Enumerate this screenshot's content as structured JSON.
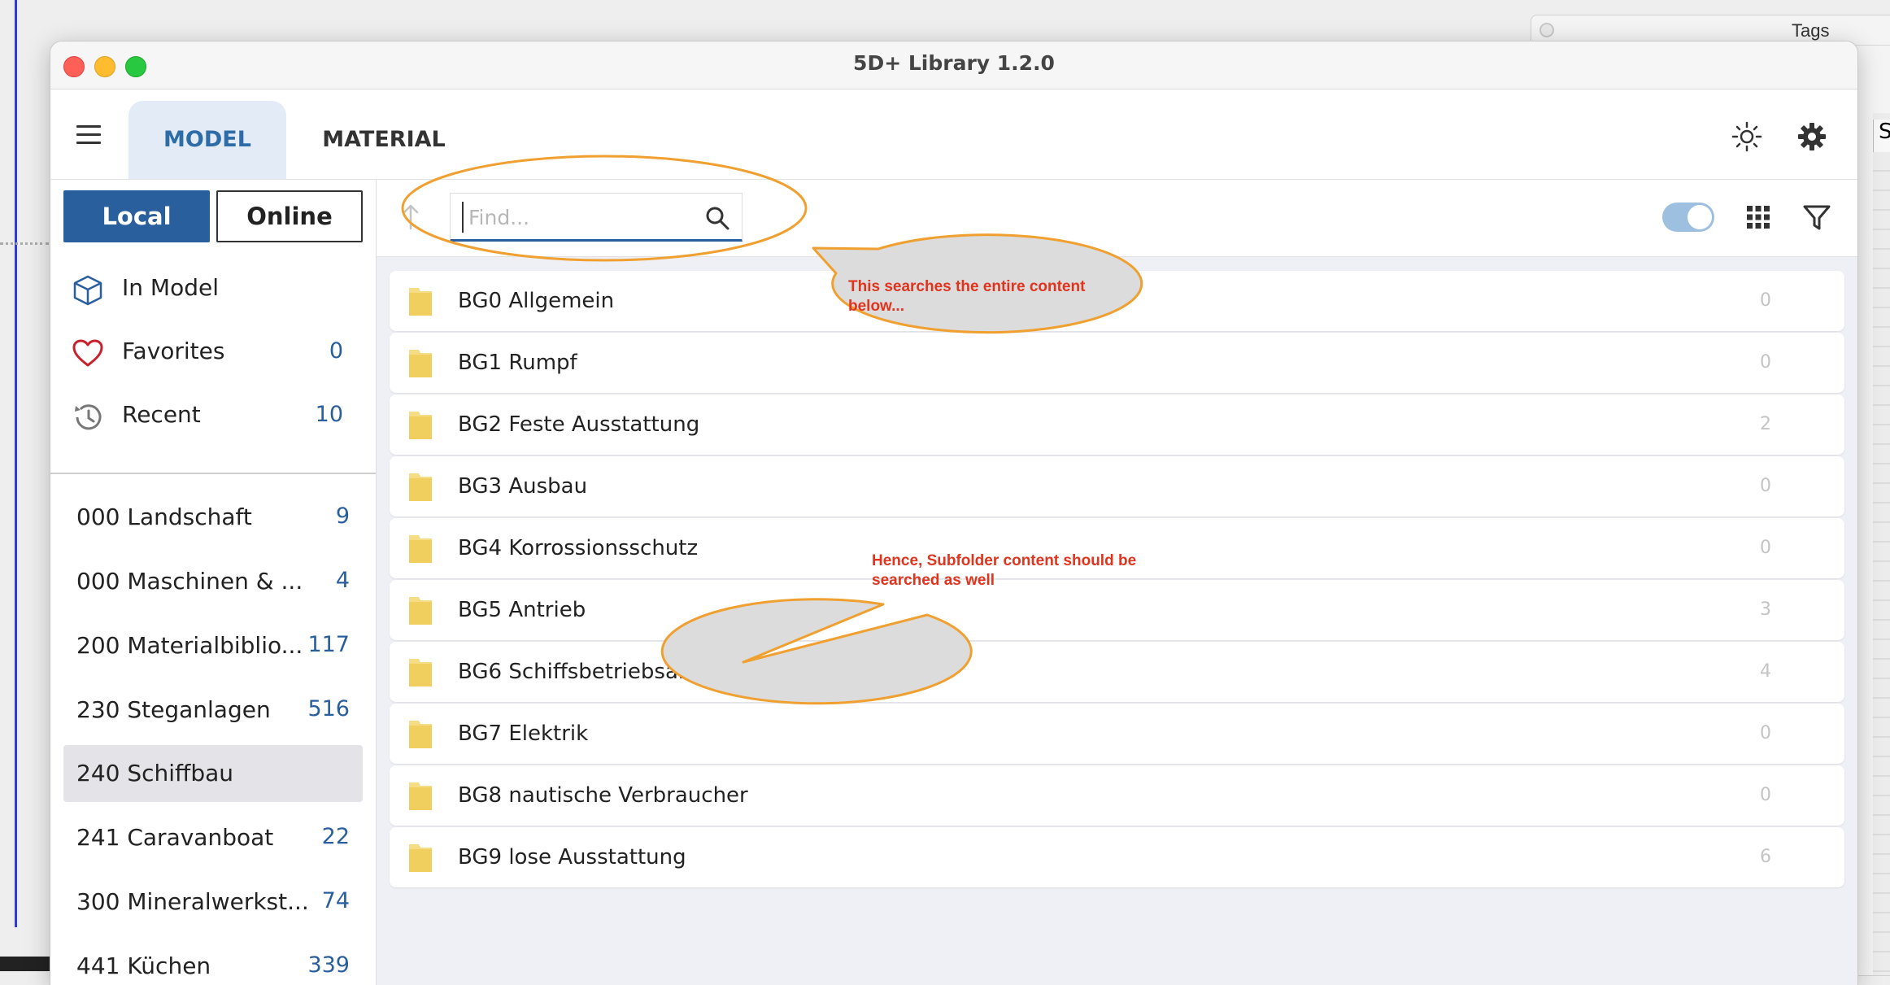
{
  "window": {
    "title": "5D+ Library 1.2.0"
  },
  "background_window": {
    "title": "Tags",
    "edge_letter": "S"
  },
  "topbar": {
    "tabs": [
      {
        "label": "MODEL",
        "active": true
      },
      {
        "label": "MATERIAL",
        "active": false
      }
    ],
    "icons": [
      "menu-icon",
      "sun-icon",
      "gear-icon"
    ]
  },
  "sidebar": {
    "segments": [
      {
        "label": "Local",
        "active": true
      },
      {
        "label": "Online",
        "active": false
      }
    ],
    "nav": [
      {
        "label": "In Model",
        "count": "",
        "icon": "cube-icon"
      },
      {
        "label": "Favorites",
        "count": "0",
        "icon": "heart-icon"
      },
      {
        "label": "Recent",
        "count": "10",
        "icon": "history-icon"
      }
    ],
    "categories": [
      {
        "label": "000 Landschaft",
        "count": "9"
      },
      {
        "label": "000 Maschinen & ...",
        "count": "4"
      },
      {
        "label": "200 Materialbiblio...",
        "count": "117"
      },
      {
        "label": "230 Steganlagen",
        "count": "516"
      },
      {
        "label": "240 Schiffbau",
        "count": "",
        "selected": true
      },
      {
        "label": "241 Caravanboat",
        "count": "22"
      },
      {
        "label": "300 Mineralwerkst...",
        "count": "74"
      },
      {
        "label": "441 Küchen",
        "count": "339"
      }
    ]
  },
  "toolbar": {
    "search_placeholder": "Find...",
    "toggle_on": true
  },
  "folders": [
    {
      "label": "BG0 Allgemein",
      "count": "0"
    },
    {
      "label": "BG1 Rumpf",
      "count": "0"
    },
    {
      "label": "BG2 Feste Ausstattung",
      "count": "2"
    },
    {
      "label": "BG3 Ausbau",
      "count": "0"
    },
    {
      "label": "BG4 Korrossionsschutz",
      "count": "0"
    },
    {
      "label": "BG5 Antrieb",
      "count": "3"
    },
    {
      "label": "BG6 Schiffsbetriebsanlagen",
      "count": "4"
    },
    {
      "label": "BG7 Elektrik",
      "count": "0"
    },
    {
      "label": "BG8 nautische Verbraucher",
      "count": "0"
    },
    {
      "label": "BG9 lose Ausstattung",
      "count": "6"
    }
  ],
  "annotations": {
    "callout_1": "This searches the entire content below...",
    "callout_2": "Hence, Subfolder content should be searched as well"
  },
  "colors": {
    "accent": "#2a5f9e",
    "tab_active_bg": "#e3ecf6",
    "folder": "#f3d77a",
    "annotation_stroke": "#f0a030",
    "annotation_text": "#e0341e"
  }
}
